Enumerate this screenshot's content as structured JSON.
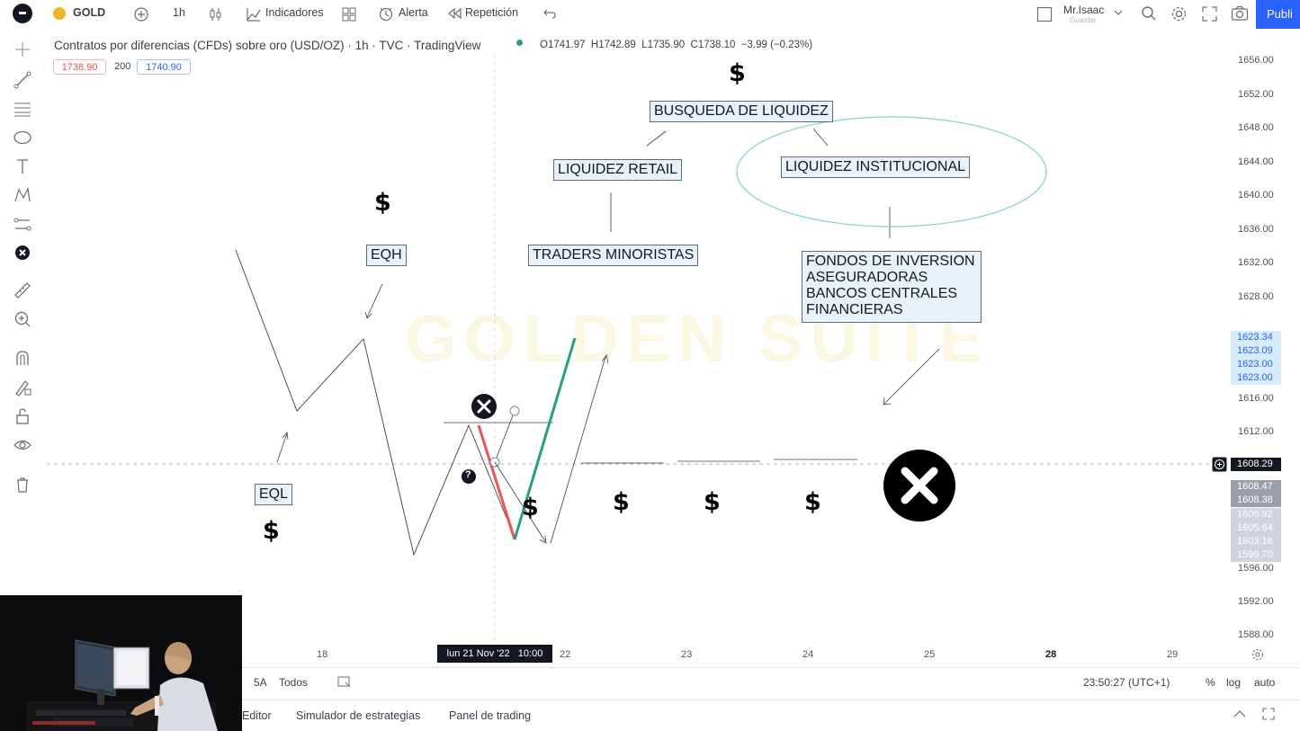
{
  "topbar": {
    "symbol": "GOLD",
    "interval": "1h",
    "indicators_label": "Indicadores",
    "alert_label": "Alerta",
    "replay_label": "Repetición",
    "user_name": "Mr.Isaac",
    "user_sub": "Guardar",
    "publish_label": "Publi"
  },
  "legend": {
    "title": "Contratos por diferencias (CFDs) sobre oro (USD/OZ) · 1h · TVC · TradingView",
    "ohlc": "O1741.97  H1742.89  L1735.90  C1738.10  −3.99 (−0.23%)",
    "bid": "1738.90",
    "spread": "200",
    "ask": "1740.90"
  },
  "annotations": {
    "busqueda": "BUSQUEDA DE LIQUIDEZ",
    "retail": "LIQUIDEZ RETAIL",
    "institucional": "LIQUIDEZ INSTITUCIONAL",
    "minoristas": "TRADERS MINORISTAS",
    "eqh": "EQH",
    "eql": "EQL",
    "fondos_1": "FONDOS DE INVERSION",
    "fondos_2": "ASEGURADORAS",
    "fondos_3": "BANCOS CENTRALES",
    "fondos_4": "FINANCIERAS",
    "dollar": "$",
    "question": "?"
  },
  "watermark": "GOLDEN SUITE",
  "price_axis": {
    "labels": [
      "1656.00",
      "1652.00",
      "1648.00",
      "1644.00",
      "1640.00",
      "1636.00",
      "1632.00",
      "1628.00",
      "1623.34",
      "1623.09",
      "1623.00",
      "1623.00",
      "1616.00",
      "1612.00",
      "1608.29",
      "1608.47",
      "1608.38",
      "1606.92",
      "1605.64",
      "1603.16",
      "1599.70",
      "1596.00",
      "1592.00",
      "1588.00"
    ],
    "current": "1608.29"
  },
  "time_axis": {
    "labels": [
      "18",
      "22",
      "23",
      "24",
      "25",
      "28",
      "29"
    ],
    "crosshair": "lun 21 Nov '22   10:00"
  },
  "bottombar": {
    "range_5y": "5A",
    "range_all": "Todos",
    "clock": "23:50:27 (UTC+1)",
    "percent": "%",
    "log": "log",
    "auto": "auto",
    "tab_editor": "Editor",
    "tab_strategy": "Simulador de estrategias",
    "tab_trading": "Panel de trading"
  },
  "colors": {
    "accent": "#2962ff",
    "bull_line": "#26a17b",
    "bear_line": "#ef5350",
    "ellipse": "#7fd6b8",
    "annotation_bg": "#e9f2fb",
    "highlight_label_bg": "#d6ecfb"
  }
}
